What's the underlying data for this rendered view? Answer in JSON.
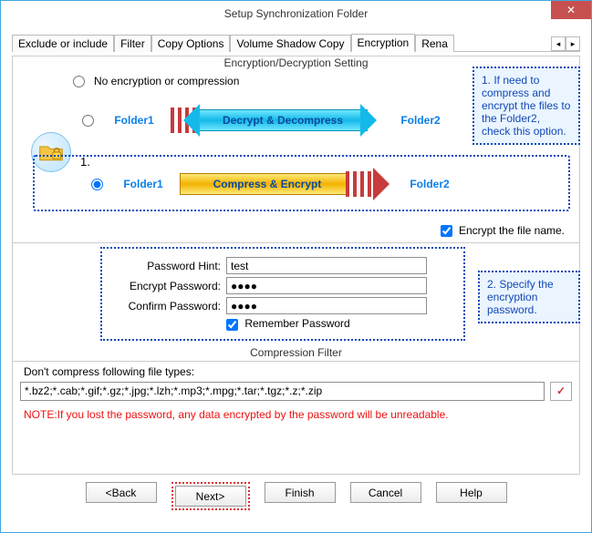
{
  "window": {
    "title": "Setup Synchronization Folder",
    "close": "✕"
  },
  "tabs": {
    "t1": "Exclude or include",
    "t2": "Filter",
    "t3": "Copy Options",
    "t4": "Volume Shadow Copy",
    "t5": "Encryption",
    "t6": "Rena",
    "spin_left": "◂",
    "spin_right": "▸"
  },
  "group": {
    "encryption_caption": "Encryption/Decryption Setting",
    "compression_caption": "Compression Filter"
  },
  "options": {
    "no_encryption": "No encryption or compression",
    "folder1": "Folder1",
    "folder2": "Folder2",
    "decrypt_label": "Decrypt & Decompress",
    "compress_label": "Compress & Encrypt",
    "step1": "1.",
    "encrypt_filename": "Encrypt the file name."
  },
  "form": {
    "hint_label": "Password Hint:",
    "hint_value": "test",
    "enc_label": "Encrypt Password:",
    "enc_value": "●●●●",
    "conf_label": "Confirm Password:",
    "conf_value": "●●●●",
    "remember": "Remember Password"
  },
  "filter": {
    "label": "Don't compress following file types:",
    "value": "*.bz2;*.cab;*.gif;*.gz;*.jpg;*.lzh;*.mp3;*.mpg;*.tar;*.tgz;*.z;*.zip",
    "check": "✓"
  },
  "note": "NOTE:If you lost the password, any data encrypted by the password will be unreadable.",
  "buttons": {
    "back": "<Back",
    "next": "Next>",
    "finish": "Finish",
    "cancel": "Cancel",
    "help": "Help"
  },
  "callouts": {
    "c1": "1. If need to compress and encrypt the files to the Folder2, check this option.",
    "c2": "2. Specify the encryption password."
  }
}
